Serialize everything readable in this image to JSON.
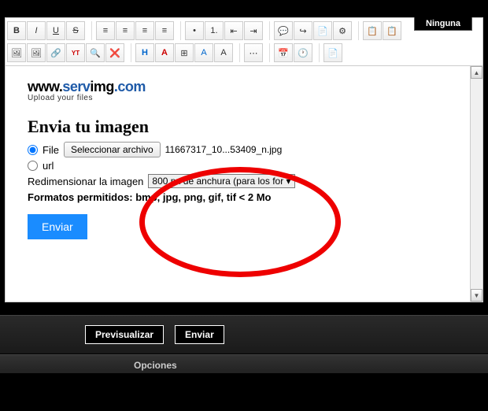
{
  "topTab": "Ninguna",
  "toolbar": {
    "row1": [
      "B",
      "I",
      "U",
      "S",
      "|",
      "≡",
      "≡",
      "≡",
      "≡",
      "|",
      "•",
      "1.",
      "⇤",
      "⇥",
      "|",
      "💬",
      "↪",
      "📄",
      "⚙",
      "|",
      "📋",
      "📋"
    ],
    "row2": [
      "🖼",
      "🖼",
      "🔗",
      "YT",
      "🔍",
      "❌",
      "|",
      "H",
      "A",
      "⊞",
      "A",
      "A",
      "|",
      "⋯",
      "|",
      "📅",
      "🕐",
      "|",
      "📄"
    ]
  },
  "logo": {
    "p1": "www.",
    "p2": "serv",
    "p3": "img",
    "p4": ".com",
    "sub": "Upload your files"
  },
  "upload": {
    "title": "Envia tu imagen",
    "fileLabel": "File",
    "chooseBtn": "Seleccionar archivo",
    "filename": "11667317_10...53409_n.jpg",
    "urlLabel": "url",
    "resizeLabel": "Redimensionar la imagen",
    "resizeOption": "800 px de anchura (para los for",
    "formats": "Formatos permitidos: bmp, jpg, png, gif, tif < 2 Mo",
    "submit": "Enviar"
  },
  "bottom": {
    "preview": "Previsualizar",
    "send": "Enviar",
    "options": "Opciones"
  }
}
